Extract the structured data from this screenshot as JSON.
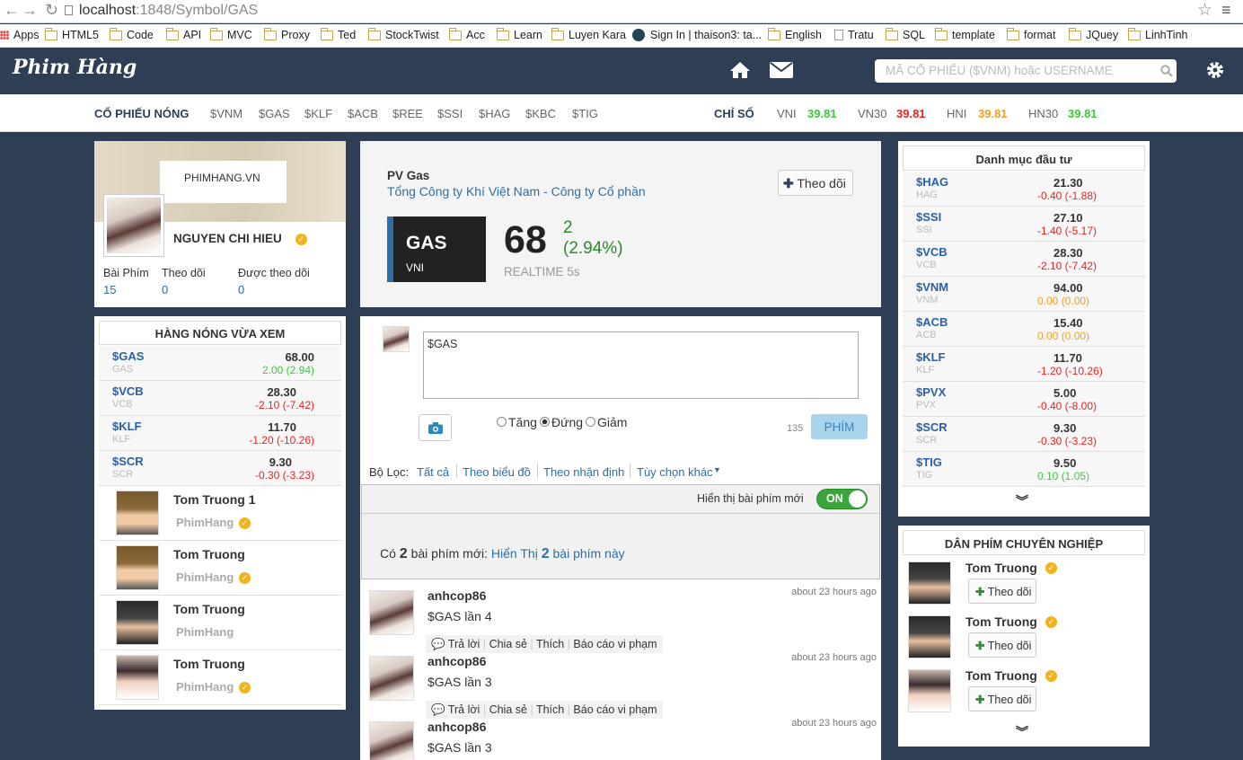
{
  "browser": {
    "url_host": "localhost",
    "url_path": ":1848/Symbol/GAS",
    "bookmarks": [
      "Apps",
      "HTML5",
      "Code",
      "API",
      "MVC",
      "Proxy",
      "Ted",
      "StockTwist",
      "Acc",
      "Learn",
      "Luyen Kara",
      "Sign In | thaison3: ta...",
      "English",
      "Tratu",
      "SQL",
      "template",
      "format",
      "JQuey",
      "LinhTinh"
    ]
  },
  "header": {
    "logo": "Phim Hàng",
    "search_placeholder": "MÃ CỔ PHIẾU ($VNM) hoặc USERNAME"
  },
  "hotbar": {
    "label": "CỔ PHIẾU NÓNG",
    "tickers": [
      "$VNM",
      "$GAS",
      "$KLF",
      "$ACB",
      "$REE",
      "$SSI",
      "$HAG",
      "$KBC",
      "$TIG"
    ],
    "index_label": "CHỈ SỐ",
    "indices": [
      {
        "name": "VNI",
        "value": "39.81",
        "color": "green"
      },
      {
        "name": "VN30",
        "value": "39.81",
        "color": "red"
      },
      {
        "name": "HNI",
        "value": "39.81",
        "color": "orange"
      },
      {
        "name": "HN30",
        "value": "39.81",
        "color": "green"
      }
    ]
  },
  "profile": {
    "cover_text": "PHIMHANG.VN",
    "name": "NGUYEN CHI HIEU",
    "stats": [
      {
        "label": "Bài Phím",
        "value": "15"
      },
      {
        "label": "Theo dõi",
        "value": "0"
      },
      {
        "label": "Được theo dõi",
        "value": "0"
      }
    ]
  },
  "recent": {
    "title": "HÀNG NÓNG VỪA XEM",
    "items": [
      {
        "sym": "$GAS",
        "sub": "GAS",
        "price": "68.00",
        "change": "2.00 (2.94)",
        "color": "green"
      },
      {
        "sym": "$VCB",
        "sub": "VCB",
        "price": "28.30",
        "change": "-2.10 (-7.42)",
        "color": "red"
      },
      {
        "sym": "$KLF",
        "sub": "KLF",
        "price": "11.70",
        "change": "-1.20 (-10.26)",
        "color": "red"
      },
      {
        "sym": "$SCR",
        "sub": "SCR",
        "price": "9.30",
        "change": "-0.30 (-3.23)",
        "color": "red"
      }
    ],
    "users": [
      {
        "name": "Tom Truong 1",
        "handle": "PhimHang",
        "verified": true
      },
      {
        "name": "Tom Truong",
        "handle": "PhimHang",
        "verified": true
      },
      {
        "name": "Tom Truong",
        "handle": "PhimHang",
        "verified": false
      },
      {
        "name": "Tom Truong",
        "handle": "PhimHang",
        "verified": true
      }
    ]
  },
  "stock": {
    "short_name": "PV Gas",
    "full_name": "Tổng Công ty Khí Việt Nam - Công ty Cổ phần",
    "follow_label": "Theo dõi",
    "symbol": "GAS",
    "exchange": "VNI",
    "price": "68",
    "change": "2",
    "change_pct": "(2.94%)",
    "realtime": "REALTIME 5s"
  },
  "composer": {
    "text": "$GAS",
    "options": [
      "Tăng",
      "Đứng",
      "Giảm"
    ],
    "selected": "Đứng",
    "count": "135",
    "submit": "PHÍM"
  },
  "filter": {
    "label": "Bộ Lọc:",
    "items": [
      "Tất cả",
      "Theo biểu đồ",
      "Theo nhận định",
      "Tùy chọn khác"
    ]
  },
  "newposts": {
    "toggle_label": "Hiển thị bài phím mới",
    "toggle_state": "ON",
    "prefix": "Có",
    "count": "2",
    "mid": "bài phím mới:",
    "link_pre": "Hiển Thị",
    "link_count": "2",
    "link_post": "bài phím này"
  },
  "posts": [
    {
      "user": "anhcop86",
      "time": "about 23 hours ago",
      "text": "$GAS lần 4"
    },
    {
      "user": "anhcop86",
      "time": "about 23 hours ago",
      "text": "$GAS lần 3"
    },
    {
      "user": "anhcop86",
      "time": "about 23 hours ago",
      "text": "$GAS lần 3"
    }
  ],
  "post_actions": [
    "Trả lời",
    "Chia sẻ",
    "Thích",
    "Báo cáo vi phạm"
  ],
  "portfolio": {
    "title": "Danh mục đầu tư",
    "items": [
      {
        "sym": "$HAG",
        "sub": "HAG",
        "price": "21.30",
        "change": "-0.40 (-1.88)",
        "color": "red"
      },
      {
        "sym": "$SSI",
        "sub": "SSI",
        "price": "27.10",
        "change": "-1.40 (-5.17)",
        "color": "red"
      },
      {
        "sym": "$VCB",
        "sub": "VCB",
        "price": "28.30",
        "change": "-2.10 (-7.42)",
        "color": "red"
      },
      {
        "sym": "$VNM",
        "sub": "VNM",
        "price": "94.00",
        "change": "0.00 (0.00)",
        "color": "orange"
      },
      {
        "sym": "$ACB",
        "sub": "ACB",
        "price": "15.40",
        "change": "0.00 (0.00)",
        "color": "orange"
      },
      {
        "sym": "$KLF",
        "sub": "KLF",
        "price": "11.70",
        "change": "-1.20 (-10.26)",
        "color": "red"
      },
      {
        "sym": "$PVX",
        "sub": "PVX",
        "price": "5.00",
        "change": "-0.40 (-8.00)",
        "color": "red"
      },
      {
        "sym": "$SCR",
        "sub": "SCR",
        "price": "9.30",
        "change": "-0.30 (-3.23)",
        "color": "red"
      },
      {
        "sym": "$TIG",
        "sub": "TIG",
        "price": "9.50",
        "change": "0.10 (1.05)",
        "color": "green"
      }
    ]
  },
  "pros": {
    "title": "DÂN PHÍM CHUYÊN NGHIỆP",
    "follow_label": "Theo dõi",
    "users": [
      "Tom Truong",
      "Tom Truong",
      "Tom Truong"
    ]
  }
}
